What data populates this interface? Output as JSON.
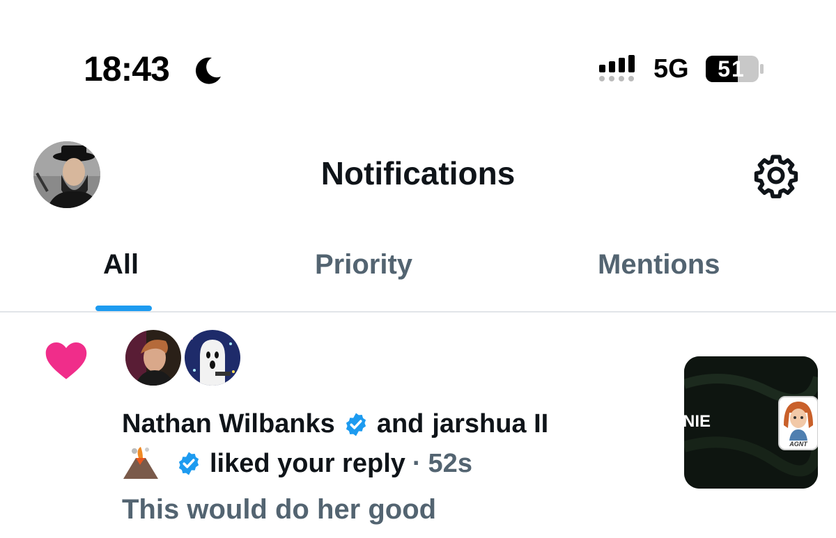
{
  "status_bar": {
    "time": "18:43",
    "network": "5G",
    "battery": "51",
    "icons": [
      "moon-icon",
      "signal-icon",
      "battery-icon"
    ]
  },
  "header": {
    "title": "Notifications",
    "icons": [
      "avatar",
      "gear-icon"
    ]
  },
  "tabs": [
    {
      "label": "All",
      "active": true
    },
    {
      "label": "Priority",
      "active": false
    },
    {
      "label": "Mentions",
      "active": false
    }
  ],
  "notification": {
    "icon": "heart-icon",
    "user1": "Nathan Wilbanks",
    "conjunction": "and",
    "user2": "jarshua II",
    "action": "liked your reply",
    "separator": "·",
    "time": "52s",
    "reply_text": "This would do her good",
    "thumbnail_text": "NIE",
    "thumbnail_caption": "AGNT"
  },
  "colors": {
    "accent": "#1d9bf0",
    "heart": "#f02d8a",
    "text": "#0f1419",
    "secondary": "#536471"
  }
}
